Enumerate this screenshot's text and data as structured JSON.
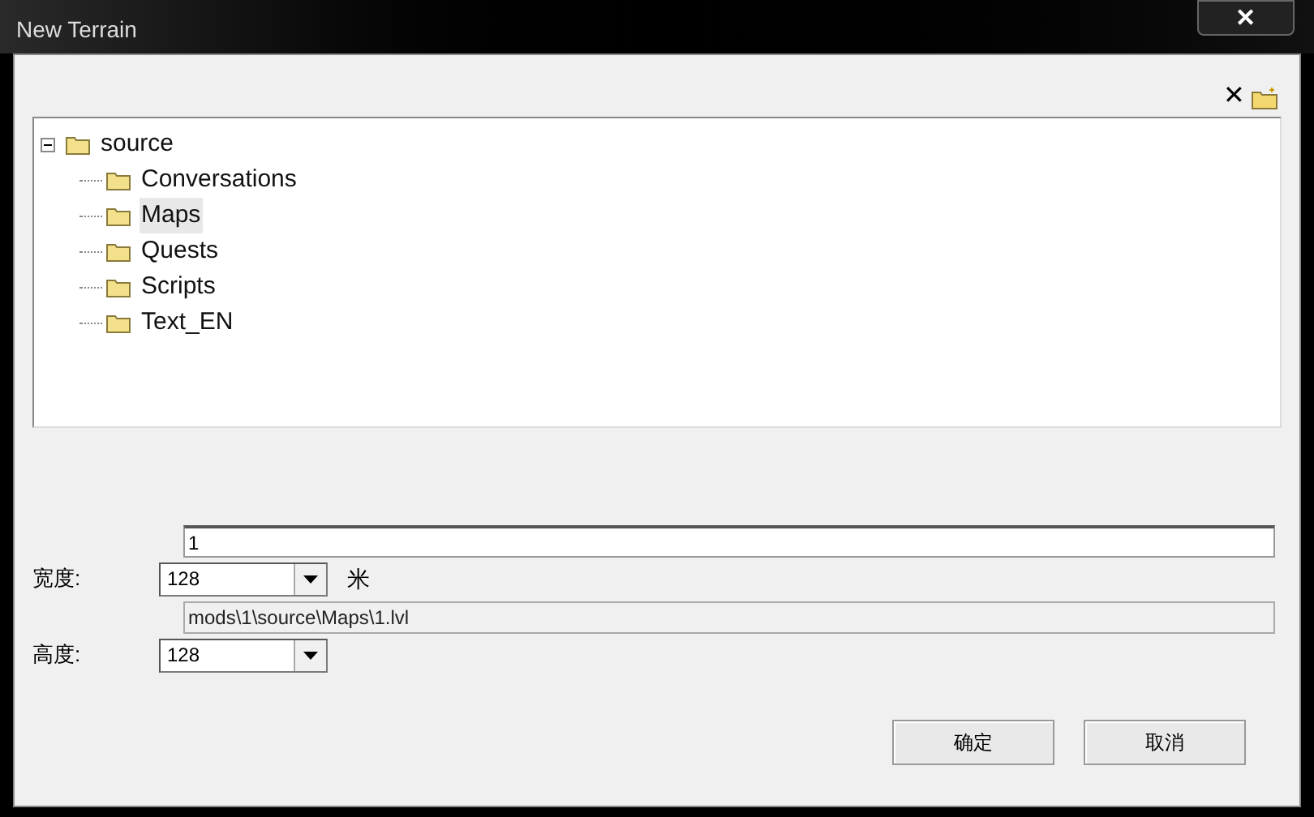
{
  "window": {
    "title": "New Terrain",
    "close": "✕"
  },
  "toolbar": {
    "delete": "✕"
  },
  "tree": {
    "label": "source",
    "expanded": true,
    "selected": false,
    "children": [
      {
        "label": "Conversations",
        "selected": false
      },
      {
        "label": "Maps",
        "selected": true
      },
      {
        "label": "Quests",
        "selected": false
      },
      {
        "label": "Scripts",
        "selected": false
      },
      {
        "label": "Text_EN",
        "selected": false
      }
    ]
  },
  "name_field": {
    "value": "1"
  },
  "width": {
    "label": "宽度:",
    "value": "128",
    "unit": "米"
  },
  "path_field": {
    "value": "mods\\1\\source\\Maps\\1.lvl"
  },
  "height": {
    "label": "高度:",
    "value": "128"
  },
  "buttons": [
    "确定",
    "取消"
  ]
}
